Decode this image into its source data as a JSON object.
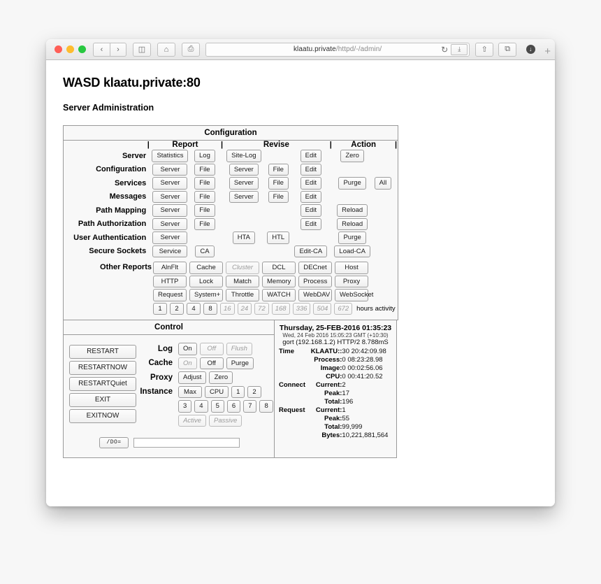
{
  "browser": {
    "url_host": "klaatu.private",
    "url_path": "/httpd/-/admin/",
    "back_icon": "‹",
    "forward_icon": "›",
    "sidebar_icon": "◫",
    "home_icon": "⌂",
    "print_icon": "⎙",
    "reload_icon": "↻",
    "reader_icon": "⤓",
    "share_icon": "⇧",
    "tabs_icon": "⧉",
    "download_icon": "↓",
    "new_tab_icon": "+"
  },
  "page": {
    "title": "WASD klaatu.private:80",
    "subtitle": "Server Administration"
  },
  "configuration": {
    "panel_title": "Configuration",
    "headers": {
      "report": "Report",
      "revise": "Revise",
      "action": "Action",
      "pipe": "|"
    },
    "rows": [
      {
        "label": "Server",
        "report": [
          "Statistics",
          "Log"
        ],
        "revise": [
          "Site-Log",
          ""
        ],
        "edit": "Edit",
        "action": [
          "Zero"
        ]
      },
      {
        "label": "Configuration",
        "report": [
          "Server",
          "File"
        ],
        "revise": [
          "Server",
          "File"
        ],
        "edit": "Edit",
        "action": []
      },
      {
        "label": "Services",
        "report": [
          "Server",
          "File"
        ],
        "revise": [
          "Server",
          "File"
        ],
        "edit": "Edit",
        "action": [
          "Purge",
          "All"
        ]
      },
      {
        "label": "Messages",
        "report": [
          "Server",
          "File"
        ],
        "revise": [
          "Server",
          "File"
        ],
        "edit": "Edit",
        "action": []
      },
      {
        "label": "Path Mapping",
        "report": [
          "Server",
          "File"
        ],
        "revise": [
          "",
          ""
        ],
        "edit": "Edit",
        "action": [
          "Reload"
        ]
      },
      {
        "label": "Path Authorization",
        "report": [
          "Server",
          "File"
        ],
        "revise": [
          "",
          ""
        ],
        "edit": "Edit",
        "action": [
          "Reload"
        ]
      },
      {
        "label": "User Authentication",
        "report": [
          "Server",
          ""
        ],
        "revise": [
          "HTA",
          "HTL"
        ],
        "edit": "",
        "action": [
          "Purge"
        ]
      },
      {
        "label": "Secure Sockets",
        "report": [
          "Service",
          "CA"
        ],
        "revise": [
          "",
          ""
        ],
        "edit": "Edit-CA",
        "action": [
          "Load-CA"
        ]
      }
    ],
    "other_reports": {
      "label": "Other Reports",
      "grid": [
        [
          {
            "text": "AlnFlt",
            "disabled": false
          },
          {
            "text": "Cache",
            "disabled": false
          },
          {
            "text": "Cluster",
            "disabled": true
          },
          {
            "text": "DCL",
            "disabled": false
          },
          {
            "text": "DECnet",
            "disabled": false
          },
          {
            "text": "Host",
            "disabled": false
          }
        ],
        [
          {
            "text": "HTTP",
            "disabled": false
          },
          {
            "text": "Lock",
            "disabled": false
          },
          {
            "text": "Match",
            "disabled": false
          },
          {
            "text": "Memory",
            "disabled": false
          },
          {
            "text": "Process",
            "disabled": false
          },
          {
            "text": "Proxy",
            "disabled": false
          }
        ],
        [
          {
            "text": "Request",
            "disabled": false
          },
          {
            "text": "System+",
            "disabled": false
          },
          {
            "text": "Throttle",
            "disabled": false
          },
          {
            "text": "WATCH",
            "disabled": false
          },
          {
            "text": "WebDAV",
            "disabled": false
          },
          {
            "text": "WebSocket",
            "disabled": false
          }
        ]
      ],
      "hours": [
        {
          "text": "1",
          "disabled": false
        },
        {
          "text": "2",
          "disabled": false
        },
        {
          "text": "4",
          "disabled": false
        },
        {
          "text": "8",
          "disabled": false
        },
        {
          "text": "16",
          "disabled": true
        },
        {
          "text": "24",
          "disabled": true
        },
        {
          "text": "72",
          "disabled": true
        },
        {
          "text": "168",
          "disabled": true
        },
        {
          "text": "336",
          "disabled": true
        },
        {
          "text": "504",
          "disabled": true
        },
        {
          "text": "672",
          "disabled": true
        }
      ],
      "hours_caption": "hours activity"
    }
  },
  "control": {
    "panel_title": "Control",
    "main_buttons": [
      "RESTART",
      "RESTARTNOW",
      "RESTARTQuiet",
      "EXIT",
      "EXITNOW"
    ],
    "lines": [
      {
        "label": "Log",
        "buttons": [
          {
            "text": "On",
            "disabled": false
          },
          {
            "text": "Off",
            "disabled": true
          },
          {
            "text": "Flush",
            "disabled": true
          }
        ]
      },
      {
        "label": "Cache",
        "buttons": [
          {
            "text": "On",
            "disabled": true
          },
          {
            "text": "Off",
            "disabled": false
          },
          {
            "text": "Purge",
            "disabled": false
          }
        ]
      },
      {
        "label": "Proxy",
        "buttons": [
          {
            "text": "Adjust",
            "disabled": false
          },
          {
            "text": "Zero",
            "disabled": false
          }
        ]
      },
      {
        "label": "Instance",
        "buttons": [
          {
            "text": "Max",
            "disabled": false
          },
          {
            "text": "CPU",
            "disabled": false
          },
          {
            "text": "1",
            "disabled": false
          },
          {
            "text": "2",
            "disabled": false
          }
        ]
      }
    ],
    "instance_row2": [
      {
        "text": "3",
        "disabled": false
      },
      {
        "text": "4",
        "disabled": false
      },
      {
        "text": "5",
        "disabled": false
      },
      {
        "text": "6",
        "disabled": false
      },
      {
        "text": "7",
        "disabled": false
      },
      {
        "text": "8",
        "disabled": false
      }
    ],
    "instance_row3": [
      {
        "text": "Active",
        "disabled": true
      },
      {
        "text": "Passive",
        "disabled": true
      }
    ],
    "do_button": "/DO=",
    "do_value": "",
    "do_placeholder": ""
  },
  "status": {
    "datetime": "Thursday, 25-FEB-2016 01:35:23",
    "gmt_line": "Wed, 24 Feb 2016 15:05:23 GMT (+10:30)",
    "host_line": "gort (192.168.1.2) HTTP/2 8.788mS",
    "groups": [
      {
        "name": "Time",
        "items": [
          {
            "key": "KLAATU::",
            "value": "30 20:42:09.98"
          },
          {
            "key": "Process:",
            "value": "0 08:23:28.98"
          },
          {
            "key": "Image:",
            "value": "0 00:02:56.06"
          },
          {
            "key": "CPU:",
            "value": "0 00:41:20.52"
          }
        ]
      },
      {
        "name": "Connect",
        "items": [
          {
            "key": "Current:",
            "value": "2"
          },
          {
            "key": "Peak:",
            "value": "17"
          },
          {
            "key": "Total:",
            "value": "196"
          }
        ]
      },
      {
        "name": "Request",
        "items": [
          {
            "key": "Current:",
            "value": "1"
          },
          {
            "key": "Peak:",
            "value": "55"
          },
          {
            "key": "Total:",
            "value": "99,999"
          },
          {
            "key": "Bytes:",
            "value": "10,221,881,564"
          }
        ]
      }
    ]
  }
}
